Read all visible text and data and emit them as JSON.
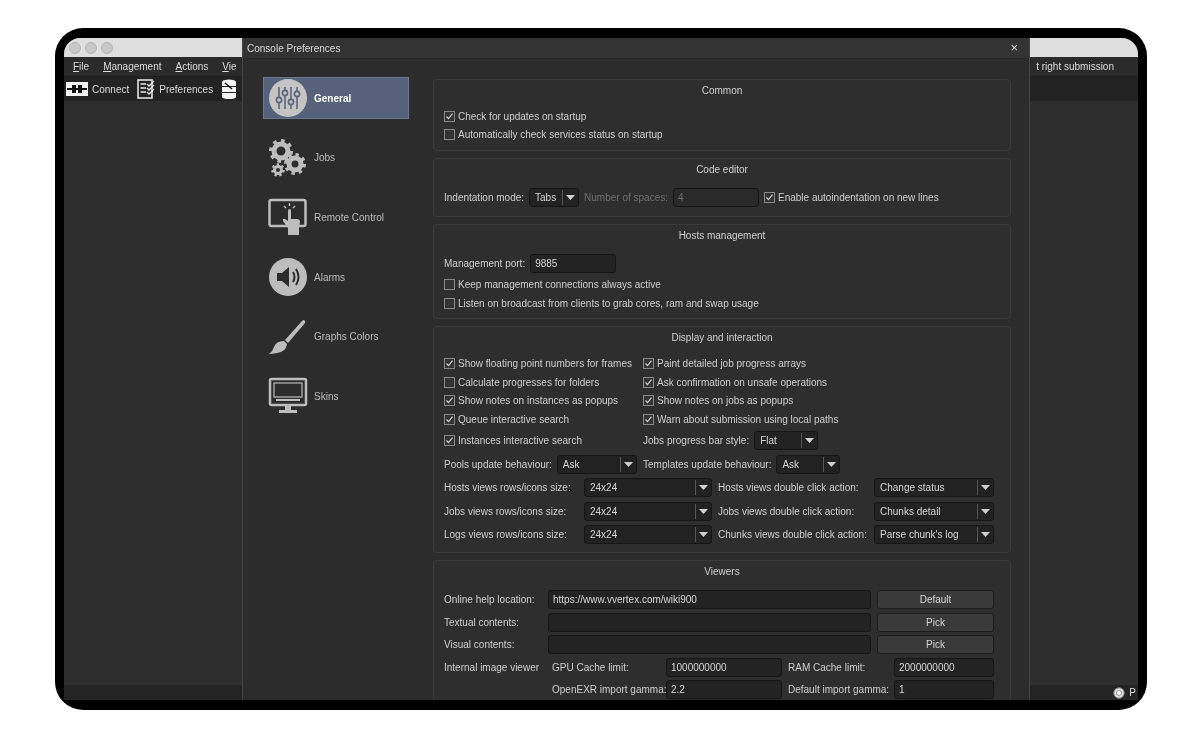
{
  "main_window": {
    "menu": [
      {
        "label": "File"
      },
      {
        "label": "Management"
      },
      {
        "label": "Actions"
      },
      {
        "label": "Vie"
      }
    ],
    "menu_tail": "t right submission",
    "toolbar": [
      {
        "kind": "plug",
        "label": "Connect"
      },
      {
        "kind": "checklist",
        "label": "Preferences"
      },
      {
        "kind": "database"
      }
    ],
    "status_text": "P"
  },
  "dialog": {
    "title": "Console Preferences",
    "close": "×",
    "sidebar": [
      {
        "kind": "sliders",
        "label": "General",
        "selected": true
      },
      {
        "kind": "gears",
        "label": "Jobs",
        "selected": false
      },
      {
        "kind": "touch",
        "label": "Remote Control",
        "selected": false
      },
      {
        "kind": "speaker",
        "label": "Alarms",
        "selected": false
      },
      {
        "kind": "brush",
        "label": "Graphs Colors",
        "selected": false
      },
      {
        "kind": "monitor",
        "label": "Skins",
        "selected": false
      }
    ],
    "sections": [
      {
        "title": "Common",
        "rows": [
          {
            "kind": "line",
            "cells": [
              [
                {
                  "kind": "checkbox",
                  "label": "Check for updates on startup",
                  "checked": true
                }
              ]
            ]
          },
          {
            "kind": "line",
            "cells": [
              [
                {
                  "kind": "checkbox",
                  "label": "Automatically check services status on startup",
                  "checked": false
                }
              ]
            ]
          }
        ]
      },
      {
        "title": "Code editor",
        "rows": [
          {
            "kind": "line",
            "cells": [
              [
                {
                  "kind": "text",
                  "text": "Indentation mode:",
                  "disabled": false
                },
                {
                  "kind": "combo",
                  "value": "Tabs",
                  "disabled": false
                },
                {
                  "kind": "text",
                  "text": "Number of spaces:",
                  "disabled": true
                },
                {
                  "kind": "field",
                  "value": "4",
                  "disabled": true
                },
                {
                  "kind": "checkbox",
                  "label": "Enable autoindentation on new lines",
                  "checked": true,
                  "disabled": false
                }
              ]
            ]
          }
        ]
      },
      {
        "title": "Hosts management",
        "rows": [
          {
            "kind": "line",
            "cells": [
              [
                {
                  "kind": "text",
                  "text": "Management port:"
                },
                {
                  "kind": "field",
                  "value": "9885"
                }
              ]
            ]
          },
          {
            "kind": "line",
            "cells": [
              [
                {
                  "kind": "checkbox",
                  "label": "Keep management connections always active",
                  "checked": false
                }
              ]
            ]
          },
          {
            "kind": "line",
            "cells": [
              [
                {
                  "kind": "checkbox",
                  "label": "Listen on broadcast from clients to grab cores, ram and swap usage",
                  "checked": false
                }
              ]
            ]
          }
        ]
      },
      {
        "title": "Display and interaction",
        "rows": [
          {
            "kind": "split",
            "cells": [
              [
                {
                  "kind": "checkbox",
                  "label": "Show floating point numbers for frames",
                  "checked": true
                }
              ],
              [
                {
                  "kind": "checkbox",
                  "label": "Paint detailed job progress arrays",
                  "checked": true
                }
              ]
            ]
          },
          {
            "kind": "split",
            "cells": [
              [
                {
                  "kind": "checkbox",
                  "label": "Calculate progresses for folders",
                  "checked": false
                }
              ],
              [
                {
                  "kind": "checkbox",
                  "label": "Ask confirmation on unsafe operations",
                  "checked": true
                }
              ]
            ]
          },
          {
            "kind": "split",
            "cells": [
              [
                {
                  "kind": "checkbox",
                  "label": "Show notes on instances as popups",
                  "checked": true
                }
              ],
              [
                {
                  "kind": "checkbox",
                  "label": "Show notes on jobs as popups",
                  "checked": true
                }
              ]
            ]
          },
          {
            "kind": "split",
            "cells": [
              [
                {
                  "kind": "checkbox",
                  "label": "Queue interactive search",
                  "checked": true
                }
              ],
              [
                {
                  "kind": "checkbox",
                  "label": "Warn about submission using local paths",
                  "checked": true
                }
              ]
            ]
          },
          {
            "kind": "split",
            "cells": [
              [
                {
                  "kind": "checkbox",
                  "label": "Instances interactive search",
                  "checked": true
                }
              ],
              [
                {
                  "kind": "text",
                  "text": "Jobs progress bar style:"
                },
                {
                  "kind": "combo",
                  "value": "Flat"
                }
              ]
            ]
          },
          {
            "kind": "split",
            "cells": [
              [
                {
                  "kind": "text",
                  "text": "Pools update behaviour:"
                },
                {
                  "kind": "combo",
                  "value": "Ask"
                }
              ],
              [
                {
                  "kind": "text",
                  "text": "Templates update behaviour:"
                },
                {
                  "kind": "combo",
                  "value": "Ask"
                }
              ]
            ]
          },
          {
            "kind": "quad",
            "cells": [
              [
                {
                  "kind": "text",
                  "text": "Hosts views rows/icons size:"
                }
              ],
              [
                {
                  "kind": "combo",
                  "value": "24x24"
                }
              ],
              [
                {
                  "kind": "text",
                  "text": "Hosts views double click action:"
                }
              ],
              [
                {
                  "kind": "combo",
                  "value": "Change status"
                }
              ]
            ]
          },
          {
            "kind": "quad",
            "cells": [
              [
                {
                  "kind": "text",
                  "text": "Jobs views rows/icons size:"
                }
              ],
              [
                {
                  "kind": "combo",
                  "value": "24x24"
                }
              ],
              [
                {
                  "kind": "text",
                  "text": "Jobs views double click action:"
                }
              ],
              [
                {
                  "kind": "combo",
                  "value": "Chunks detail"
                }
              ]
            ]
          },
          {
            "kind": "quad",
            "cells": [
              [
                {
                  "kind": "text",
                  "text": "Logs views rows/icons size:"
                }
              ],
              [
                {
                  "kind": "combo",
                  "value": "24x24"
                }
              ],
              [
                {
                  "kind": "text",
                  "text": "Chunks views double click action:"
                }
              ],
              [
                {
                  "kind": "combo",
                  "value": "Parse chunk's log"
                }
              ]
            ]
          }
        ]
      },
      {
        "title": "Viewers",
        "rows": [
          {
            "kind": "viewer",
            "cells": [
              [
                {
                  "kind": "text",
                  "text": "Online help location:"
                }
              ],
              [
                {
                  "kind": "field",
                  "value": "https://www.vvertex.com/wiki900"
                }
              ],
              [
                {
                  "kind": "button",
                  "label": "Default"
                }
              ]
            ]
          },
          {
            "kind": "viewer",
            "cells": [
              [
                {
                  "kind": "text",
                  "text": "Textual contents:"
                }
              ],
              [
                {
                  "kind": "field"
                }
              ],
              [
                {
                  "kind": "button",
                  "label": "Pick"
                }
              ]
            ]
          },
          {
            "kind": "viewer",
            "cells": [
              [
                {
                  "kind": "text",
                  "text": "Visual contents:"
                }
              ],
              [
                {
                  "kind": "field"
                }
              ],
              [
                {
                  "kind": "button",
                  "label": "Pick"
                }
              ]
            ]
          },
          {
            "kind": "image",
            "cells": [
              [
                {
                  "kind": "text",
                  "text": "Internal image viewer"
                }
              ],
              [
                {
                  "kind": "text",
                  "text": "GPU Cache limit:"
                }
              ],
              [
                {
                  "kind": "field",
                  "value": "1000000000"
                }
              ],
              [
                {
                  "kind": "text",
                  "text": "RAM Cache limit:"
                }
              ],
              [
                {
                  "kind": "field",
                  "value": "2000000000"
                }
              ]
            ]
          },
          {
            "kind": "image",
            "cells": [
              [],
              [
                {
                  "kind": "text",
                  "text": "OpenEXR import gamma:"
                }
              ],
              [
                {
                  "kind": "field",
                  "value": "2.2"
                }
              ],
              [
                {
                  "kind": "text",
                  "text": "Default import gamma:"
                }
              ],
              [
                {
                  "kind": "field",
                  "value": "1"
                }
              ]
            ]
          }
        ]
      }
    ]
  }
}
